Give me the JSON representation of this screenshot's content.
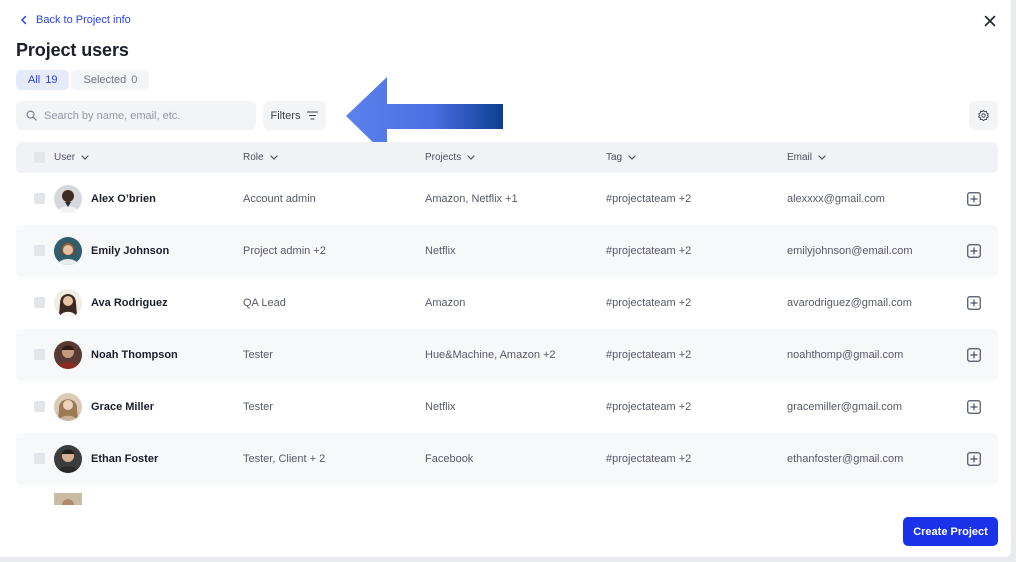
{
  "header": {
    "back_label": "Back to Project info",
    "title": "Project users"
  },
  "tabs": [
    {
      "label": "All",
      "count": "19"
    },
    {
      "label": "Selected",
      "count": "0"
    }
  ],
  "search": {
    "placeholder": "Search by name, email, etc."
  },
  "toolbar": {
    "filters_label": "Filters"
  },
  "colors": {
    "accent": "#1a33e8",
    "tab_active_bg": "#e6ebfb",
    "arrow": "#4f74e8"
  },
  "table": {
    "columns": [
      "User",
      "Role",
      "Projects",
      "Tag",
      "Email"
    ],
    "rows": [
      {
        "name": "Alex O’brien",
        "role": "Account admin",
        "projects": "Amazon, Netflix +1",
        "tag": "#projectateam +2",
        "email": "alexxxx@gmail.com"
      },
      {
        "name": "Emily Johnson",
        "role": "Project admin +2",
        "projects": "Netflix",
        "tag": "#projectateam +2",
        "email": "emilyjohnson@email.com"
      },
      {
        "name": "Ava Rodriguez",
        "role": "QA Lead",
        "projects": "Amazon",
        "tag": "#projectateam +2",
        "email": "avarodriguez@gmail.com"
      },
      {
        "name": "Noah Thompson",
        "role": "Tester",
        "projects": "Hue&Machine, Amazon +2",
        "tag": "#projectateam +2",
        "email": "noahthomp@gmail.com"
      },
      {
        "name": "Grace Miller",
        "role": "Tester",
        "projects": "Netflix",
        "tag": "#projectateam +2",
        "email": "gracemiller@gmail.com"
      },
      {
        "name": "Ethan Foster",
        "role": "Tester, Client + 2",
        "projects": "Facebook",
        "tag": "#projectateam +2",
        "email": "ethanfoster@gmail.com"
      }
    ]
  },
  "footer": {
    "create_label": "Create Project"
  }
}
